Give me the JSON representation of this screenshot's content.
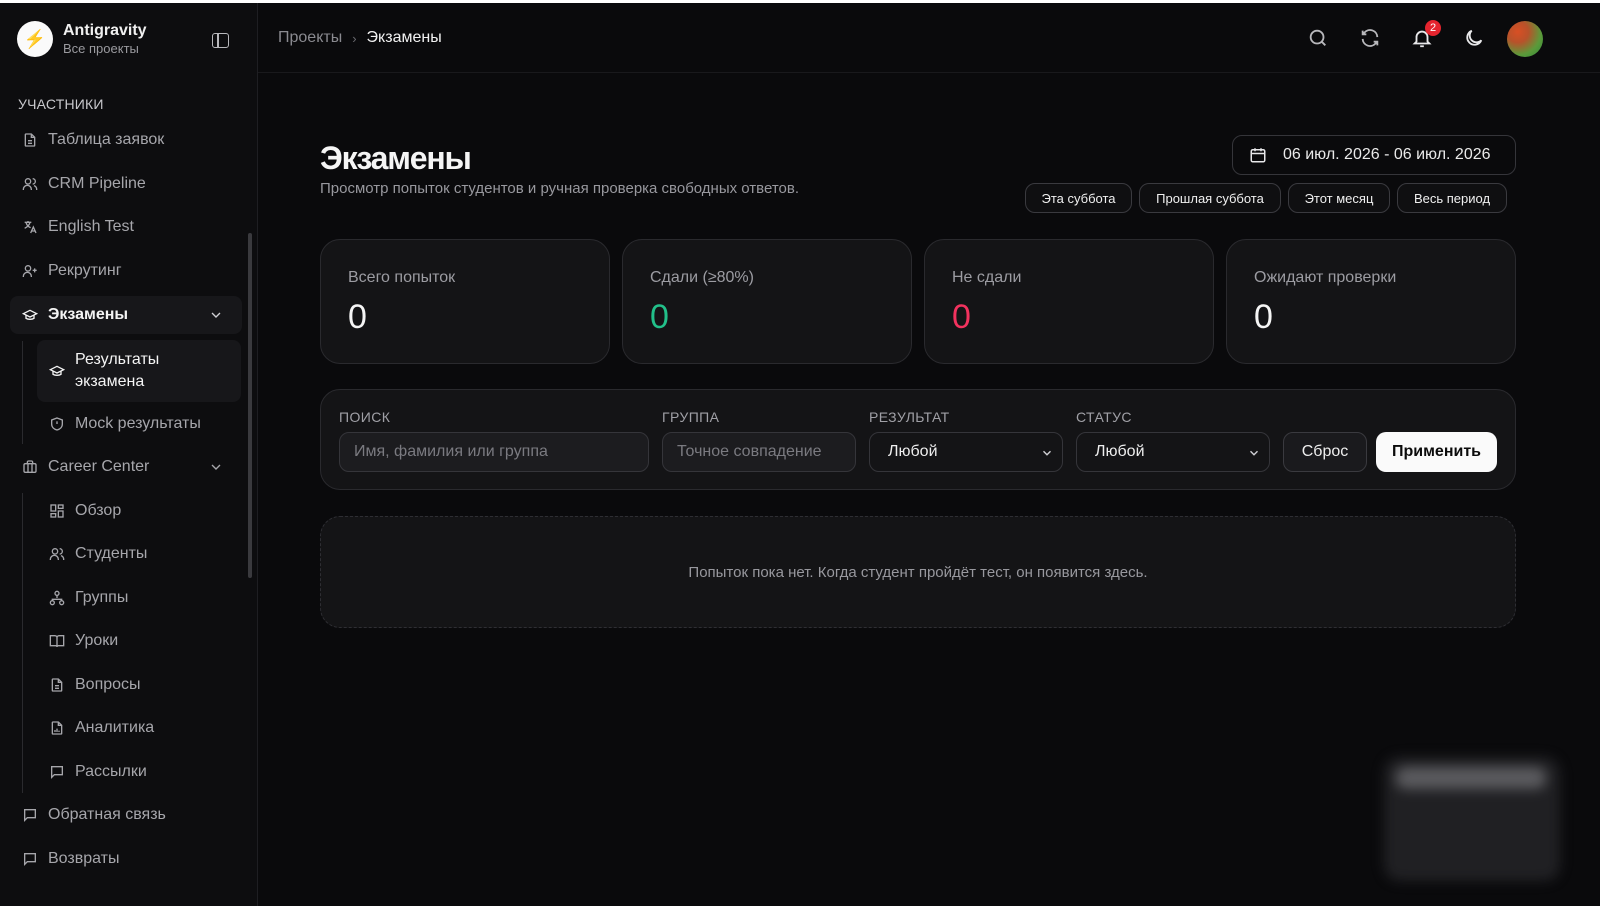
{
  "brand": {
    "name": "Antigravity",
    "subtitle": "Все проекты",
    "logo_icon": "lightning-icon"
  },
  "sidebar": {
    "section_label": "УЧАСТНИКИ",
    "items": [
      {
        "label": "Таблица заявок",
        "icon": "document-icon"
      },
      {
        "label": "CRM Pipeline",
        "icon": "users-icon"
      },
      {
        "label": "English Test",
        "icon": "translate-icon"
      },
      {
        "label": "Рекрутинг",
        "icon": "user-plus-icon"
      },
      {
        "label": "Экзамены",
        "icon": "graduation-cap-icon"
      },
      {
        "label": "Career Center",
        "icon": "briefcase-icon"
      },
      {
        "label": "Обратная связь",
        "icon": "message-icon"
      },
      {
        "label": "Возвраты",
        "icon": "message-icon"
      }
    ],
    "exam_sub": [
      {
        "label": "Результаты экзамена",
        "icon": "graduation-cap-icon"
      },
      {
        "label": "Mock результаты",
        "icon": "shield-icon"
      }
    ],
    "career_sub": [
      {
        "label": "Обзор",
        "icon": "dashboard-icon"
      },
      {
        "label": "Студенты",
        "icon": "users-icon"
      },
      {
        "label": "Группы",
        "icon": "network-icon"
      },
      {
        "label": "Уроки",
        "icon": "book-icon"
      },
      {
        "label": "Вопросы",
        "icon": "document-icon"
      },
      {
        "label": "Аналитика",
        "icon": "chart-file-icon"
      },
      {
        "label": "Рассылки",
        "icon": "message-icon"
      }
    ]
  },
  "header": {
    "breadcrumb": [
      "Проекты",
      "Экзамены"
    ],
    "notifications_count": "2"
  },
  "page": {
    "title": "Экзамены",
    "subtitle": "Просмотр попыток студентов и ручная проверка свободных ответов.",
    "date_range": "06 июл. 2026 - 06 июл. 2026",
    "quick_filters": [
      "Эта суббота",
      "Прошлая суббота",
      "Этот месяц",
      "Весь период"
    ]
  },
  "stats": [
    {
      "label": "Всего попыток",
      "value": "0"
    },
    {
      "label": "Сдали (≥80%)",
      "value": "0"
    },
    {
      "label": "Не сдали",
      "value": "0"
    },
    {
      "label": "Ожидают проверки",
      "value": "0"
    }
  ],
  "filters": {
    "search_label": "ПОИСК",
    "search_placeholder": "Имя, фамилия или группа",
    "group_label": "ГРУППА",
    "group_placeholder": "Точное совпадение",
    "result_label": "РЕЗУЛЬТАТ",
    "result_value": "Любой",
    "status_label": "СТАТУС",
    "status_value": "Любой",
    "reset_label": "Сброс",
    "apply_label": "Применить"
  },
  "empty_state": "Попыток пока нет. Когда студент пройдёт тест, он появится здесь.",
  "colors": {
    "pass": "#22c08a",
    "fail": "#f2325e",
    "badge": "#e5242e",
    "accent_button": "#fafafa"
  }
}
